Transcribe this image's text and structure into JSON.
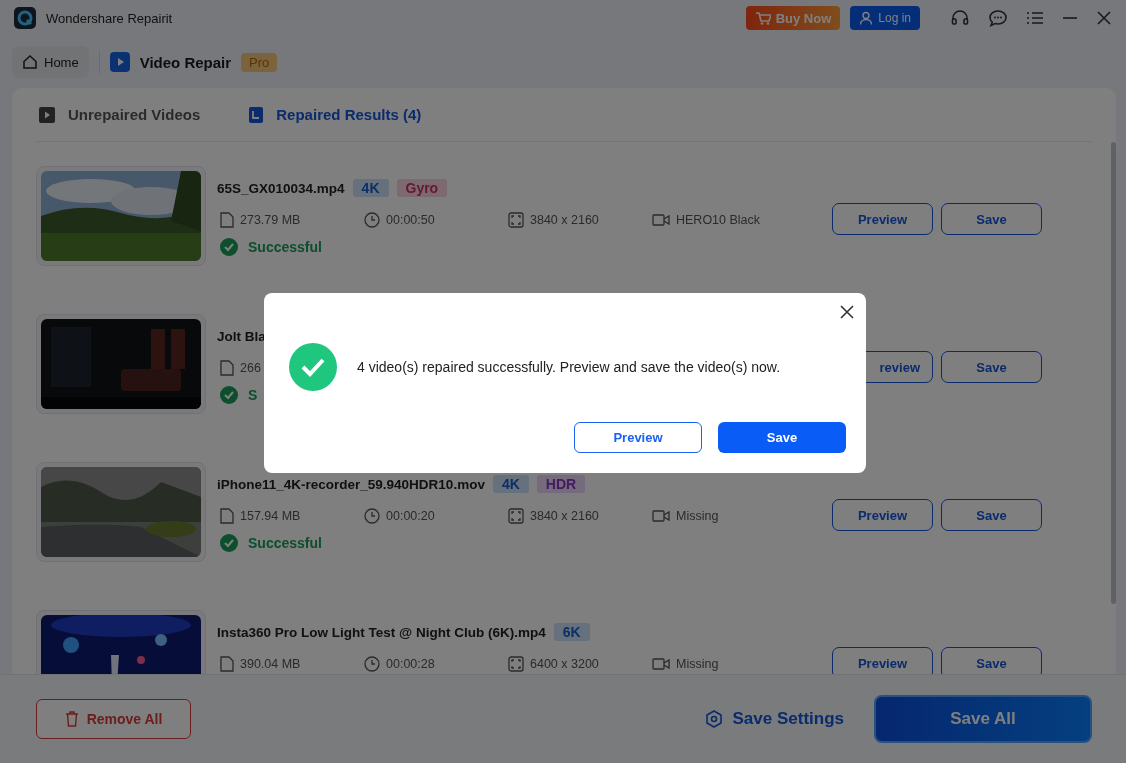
{
  "window": {
    "title": "Wondershare Repairit"
  },
  "header_buttons": [
    {
      "kind": "buy",
      "label": "Buy Now"
    },
    {
      "kind": "login",
      "label": "Log in"
    }
  ],
  "nav": {
    "home": "Home",
    "module": "Video Repair",
    "badge": "Pro"
  },
  "tabs": [
    {
      "label": "Unrepaired Videos",
      "selected": false
    },
    {
      "label": "Repaired Results (4)",
      "selected": true
    }
  ],
  "videos": [
    {
      "name": "65S_GX010034.mp4",
      "tags": [
        {
          "label": "4K",
          "color": "#67707d"
        },
        {
          "label": "Gyro",
          "color": "#7d6a71"
        }
      ],
      "size": "273.79 MB",
      "duration": "00:00:50",
      "resolution": "3840 x 2160",
      "camera": "HERO10 Black",
      "status": "Successful",
      "preview": "Preview",
      "save": "Save"
    },
    {
      "name": "Jolt Bla",
      "size": "266",
      "status": "S",
      "preview": "review",
      "save": "Save"
    },
    {
      "name": "iPhone11_4K-recorder_59.940HDR10.mov",
      "tags": [
        {
          "label": "4K",
          "color": "#67707d"
        },
        {
          "label": "HDR",
          "color": "#756b7c"
        }
      ],
      "size": "157.94 MB",
      "duration": "00:00:20",
      "resolution": "3840 x 2160",
      "camera": "Missing",
      "status": "Successful",
      "preview": "Preview",
      "save": "Save"
    },
    {
      "name": "Insta360 Pro Low Light Test @ Night Club (6K).mp4",
      "tags": [
        {
          "label": "6K",
          "color": "#67707d"
        }
      ],
      "size": "390.04 MB",
      "duration": "00:00:28",
      "resolution": "6400 x 3200",
      "camera": "Missing",
      "preview": "Preview",
      "save": "Save"
    }
  ],
  "footer": {
    "remove_all": "Remove All",
    "save_settings": "Save Settings",
    "save_all": "Save All"
  },
  "dialog": {
    "message": "4 video(s) repaired successfully. Preview and save the video(s) now.",
    "preview": "Preview",
    "save": "Save"
  }
}
